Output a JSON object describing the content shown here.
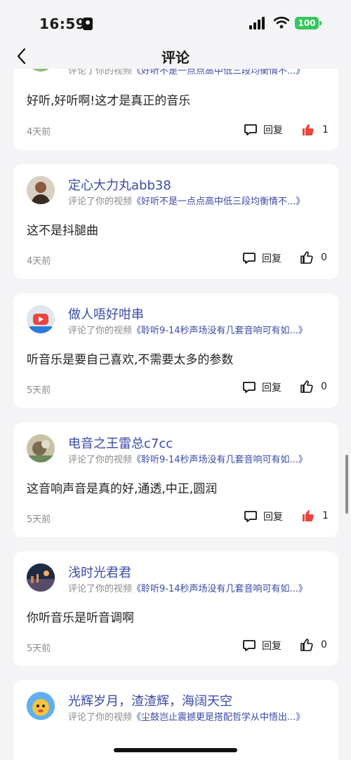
{
  "status": {
    "time": "16:59",
    "battery": "100"
  },
  "nav": {
    "title": "评论"
  },
  "comments": [
    {
      "user": "",
      "subline_prefix": "评论了你的视频",
      "video": "《好听不是一点点高中低三段均衡情不...》",
      "text": "好听,好听啊!这才是真正的音乐",
      "date": "4天前",
      "reply_label": "回复",
      "likes": "1",
      "liked": true
    },
    {
      "user": "定心大力丸abb38",
      "subline_prefix": "评论了你的视频",
      "video": "《好听不是一点点高中低三段均衡情不...》",
      "text": "这不是抖腿曲",
      "date": "4天前",
      "reply_label": "回复",
      "likes": "0",
      "liked": false
    },
    {
      "user": "做人唔好咁串",
      "subline_prefix": "评论了你的视频",
      "video": "《聆听9-14秒声场没有几套音响可有如...》",
      "text": "听音乐是要自己喜欢,不需要太多的参数",
      "date": "5天前",
      "reply_label": "回复",
      "likes": "0",
      "liked": false
    },
    {
      "user": "电音之王雷总c7cc",
      "subline_prefix": "评论了你的视频",
      "video": "《聆听9-14秒声场没有几套音响可有如...》",
      "text": "这音响声音是真的好,通透,中正,圆润",
      "date": "5天前",
      "reply_label": "回复",
      "likes": "1",
      "liked": true
    },
    {
      "user": "浅时光君君",
      "subline_prefix": "评论了你的视频",
      "video": "《聆听9-14秒声场没有几套音响可有如...》",
      "text": "你听音乐是听音调啊",
      "date": "5天前",
      "reply_label": "回复",
      "likes": "0",
      "liked": false
    },
    {
      "user": "光辉岁月，渣渣辉，海阔天空",
      "subline_prefix": "评论了你的视频",
      "video": "《尘鼓岂止震撼更是搭配哲学从中悟出...》"
    }
  ],
  "colors": {
    "accent": "#3b4aa7",
    "like_active": "#e8453c",
    "battery": "#34c759"
  },
  "icons": {
    "back": "chevron-left-icon",
    "reply": "comment-bubble-icon",
    "like": "thumbs-up-icon"
  }
}
